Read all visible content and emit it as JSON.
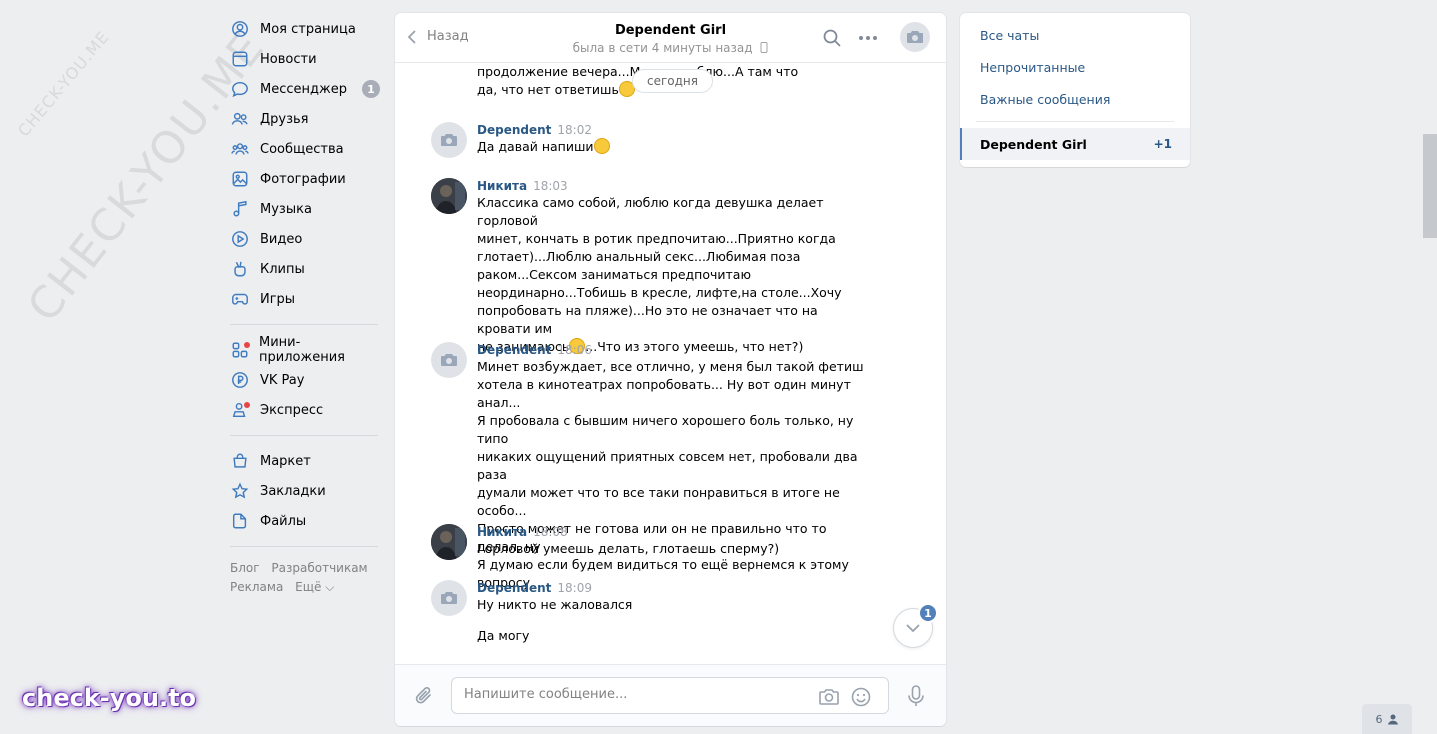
{
  "watermarks": {
    "small": "CHECK-YOU.ME",
    "big": "CHECK-YOU.ME",
    "logo": "check-you.to"
  },
  "leftnav": {
    "items": [
      {
        "label": "Моя страница",
        "icon": "user-icon"
      },
      {
        "label": "Новости",
        "icon": "news-icon"
      },
      {
        "label": "Мессенджер",
        "icon": "message-icon",
        "badge": "1"
      },
      {
        "label": "Друзья",
        "icon": "friends-icon"
      },
      {
        "label": "Сообщества",
        "icon": "communities-icon"
      },
      {
        "label": "Фотографии",
        "icon": "photo-icon"
      },
      {
        "label": "Музыка",
        "icon": "music-icon"
      },
      {
        "label": "Видео",
        "icon": "video-icon"
      },
      {
        "label": "Клипы",
        "icon": "clips-icon"
      },
      {
        "label": "Игры",
        "icon": "games-icon"
      }
    ],
    "items2": [
      {
        "label": "Мини-приложения",
        "icon": "apps-icon"
      },
      {
        "label": "VK Pay",
        "icon": "vkpay-icon"
      },
      {
        "label": "Экспресс",
        "icon": "express-icon"
      }
    ],
    "items3": [
      {
        "label": "Маркет",
        "icon": "market-icon"
      },
      {
        "label": "Закладки",
        "icon": "bookmark-icon"
      },
      {
        "label": "Файлы",
        "icon": "file-icon"
      }
    ],
    "footer": {
      "blog": "Блог",
      "developers": "Разработчикам",
      "ads": "Реклама",
      "more": "Ещё ⌵"
    }
  },
  "chat": {
    "back_label": "Назад",
    "title": "Dependent Girl",
    "subtitle": "была в сети 4 минуты назад",
    "date_pill": "сегодня",
    "messages": [
      {
        "author": "",
        "time": "",
        "text": "продолжение вечера...Мо                 что люблю...А там что\nда, что нет ответишь"
      },
      {
        "author": "Dependent",
        "time": "18:02",
        "text": "Да давай напиши"
      },
      {
        "author": "Никита",
        "time": "18:03",
        "text": "Классика само собой, люблю когда девушка делает горловой\nминет, кончать в ротик предпочитаю...Приятно когда\nглотает)...Люблю анальный секс...Любимая поза\nраком...Сексом заниматься предпочитаю\nнеординарно...Тобишь в кресле, лифте,на столе...Хочу\nпопробовать на пляже)...Но это не означает что на кровати им\nне занимаюсь"
      },
      {
        "author": "Dependent",
        "time": "18:06",
        "text": "Минет возбуждает, все отлично, у меня был такой фетиш\nхотела в кинотеатрах попробовать... Ну вот один минут анал...\nЯ пробовала с бывшим ничего хорошего боль только, ну типо\nникаких ощущений приятных совсем нет, пробовали два раза\nдумали может что то все таки понравиться в итоге не особо...\nПросто может не готова или он не правильно что то делал, ну\nЯ думаю если будем видиться то ещё вернемся к этому\nвопросу"
      },
      {
        "author": "Никита",
        "time": "18:08",
        "text": "Горловой умеешь делать, глотаешь сперму?)"
      },
      {
        "author": "Dependent",
        "time": "18:09",
        "text": "Ну никто не жаловался"
      }
    ],
    "msg3_tail": "...Что из этого умеешь, что нет?)",
    "extra_line": "Да могу",
    "scroll_badge": "1",
    "composer_placeholder": "Напишите сообщение..."
  },
  "rightpanel": {
    "all_chats": "Все чаты",
    "unread": "Непрочитанные",
    "important": "Важные сообщения",
    "active_chat": "Dependent Girl",
    "active_count": "+1"
  },
  "online_count": "6"
}
